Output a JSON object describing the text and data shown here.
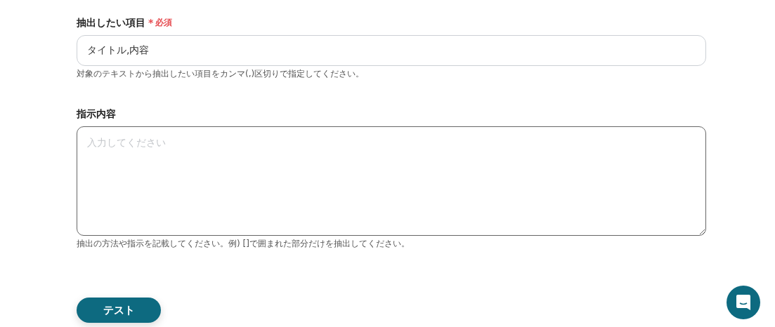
{
  "fields": [
    {
      "kind": "input",
      "label": "抽出したい項目",
      "required_mark": "*",
      "required_text": "必須",
      "value": "タイトル,内容",
      "hint": "対象のテキストから抽出したい項目をカンマ(,)区切りで指定してください。"
    },
    {
      "kind": "textarea",
      "label": "指示内容",
      "placeholder": "入力してください",
      "hint": "抽出の方法や指示を記載してください。例) []で囲まれた部分だけを抽出してください。"
    }
  ],
  "test_button": "テスト"
}
